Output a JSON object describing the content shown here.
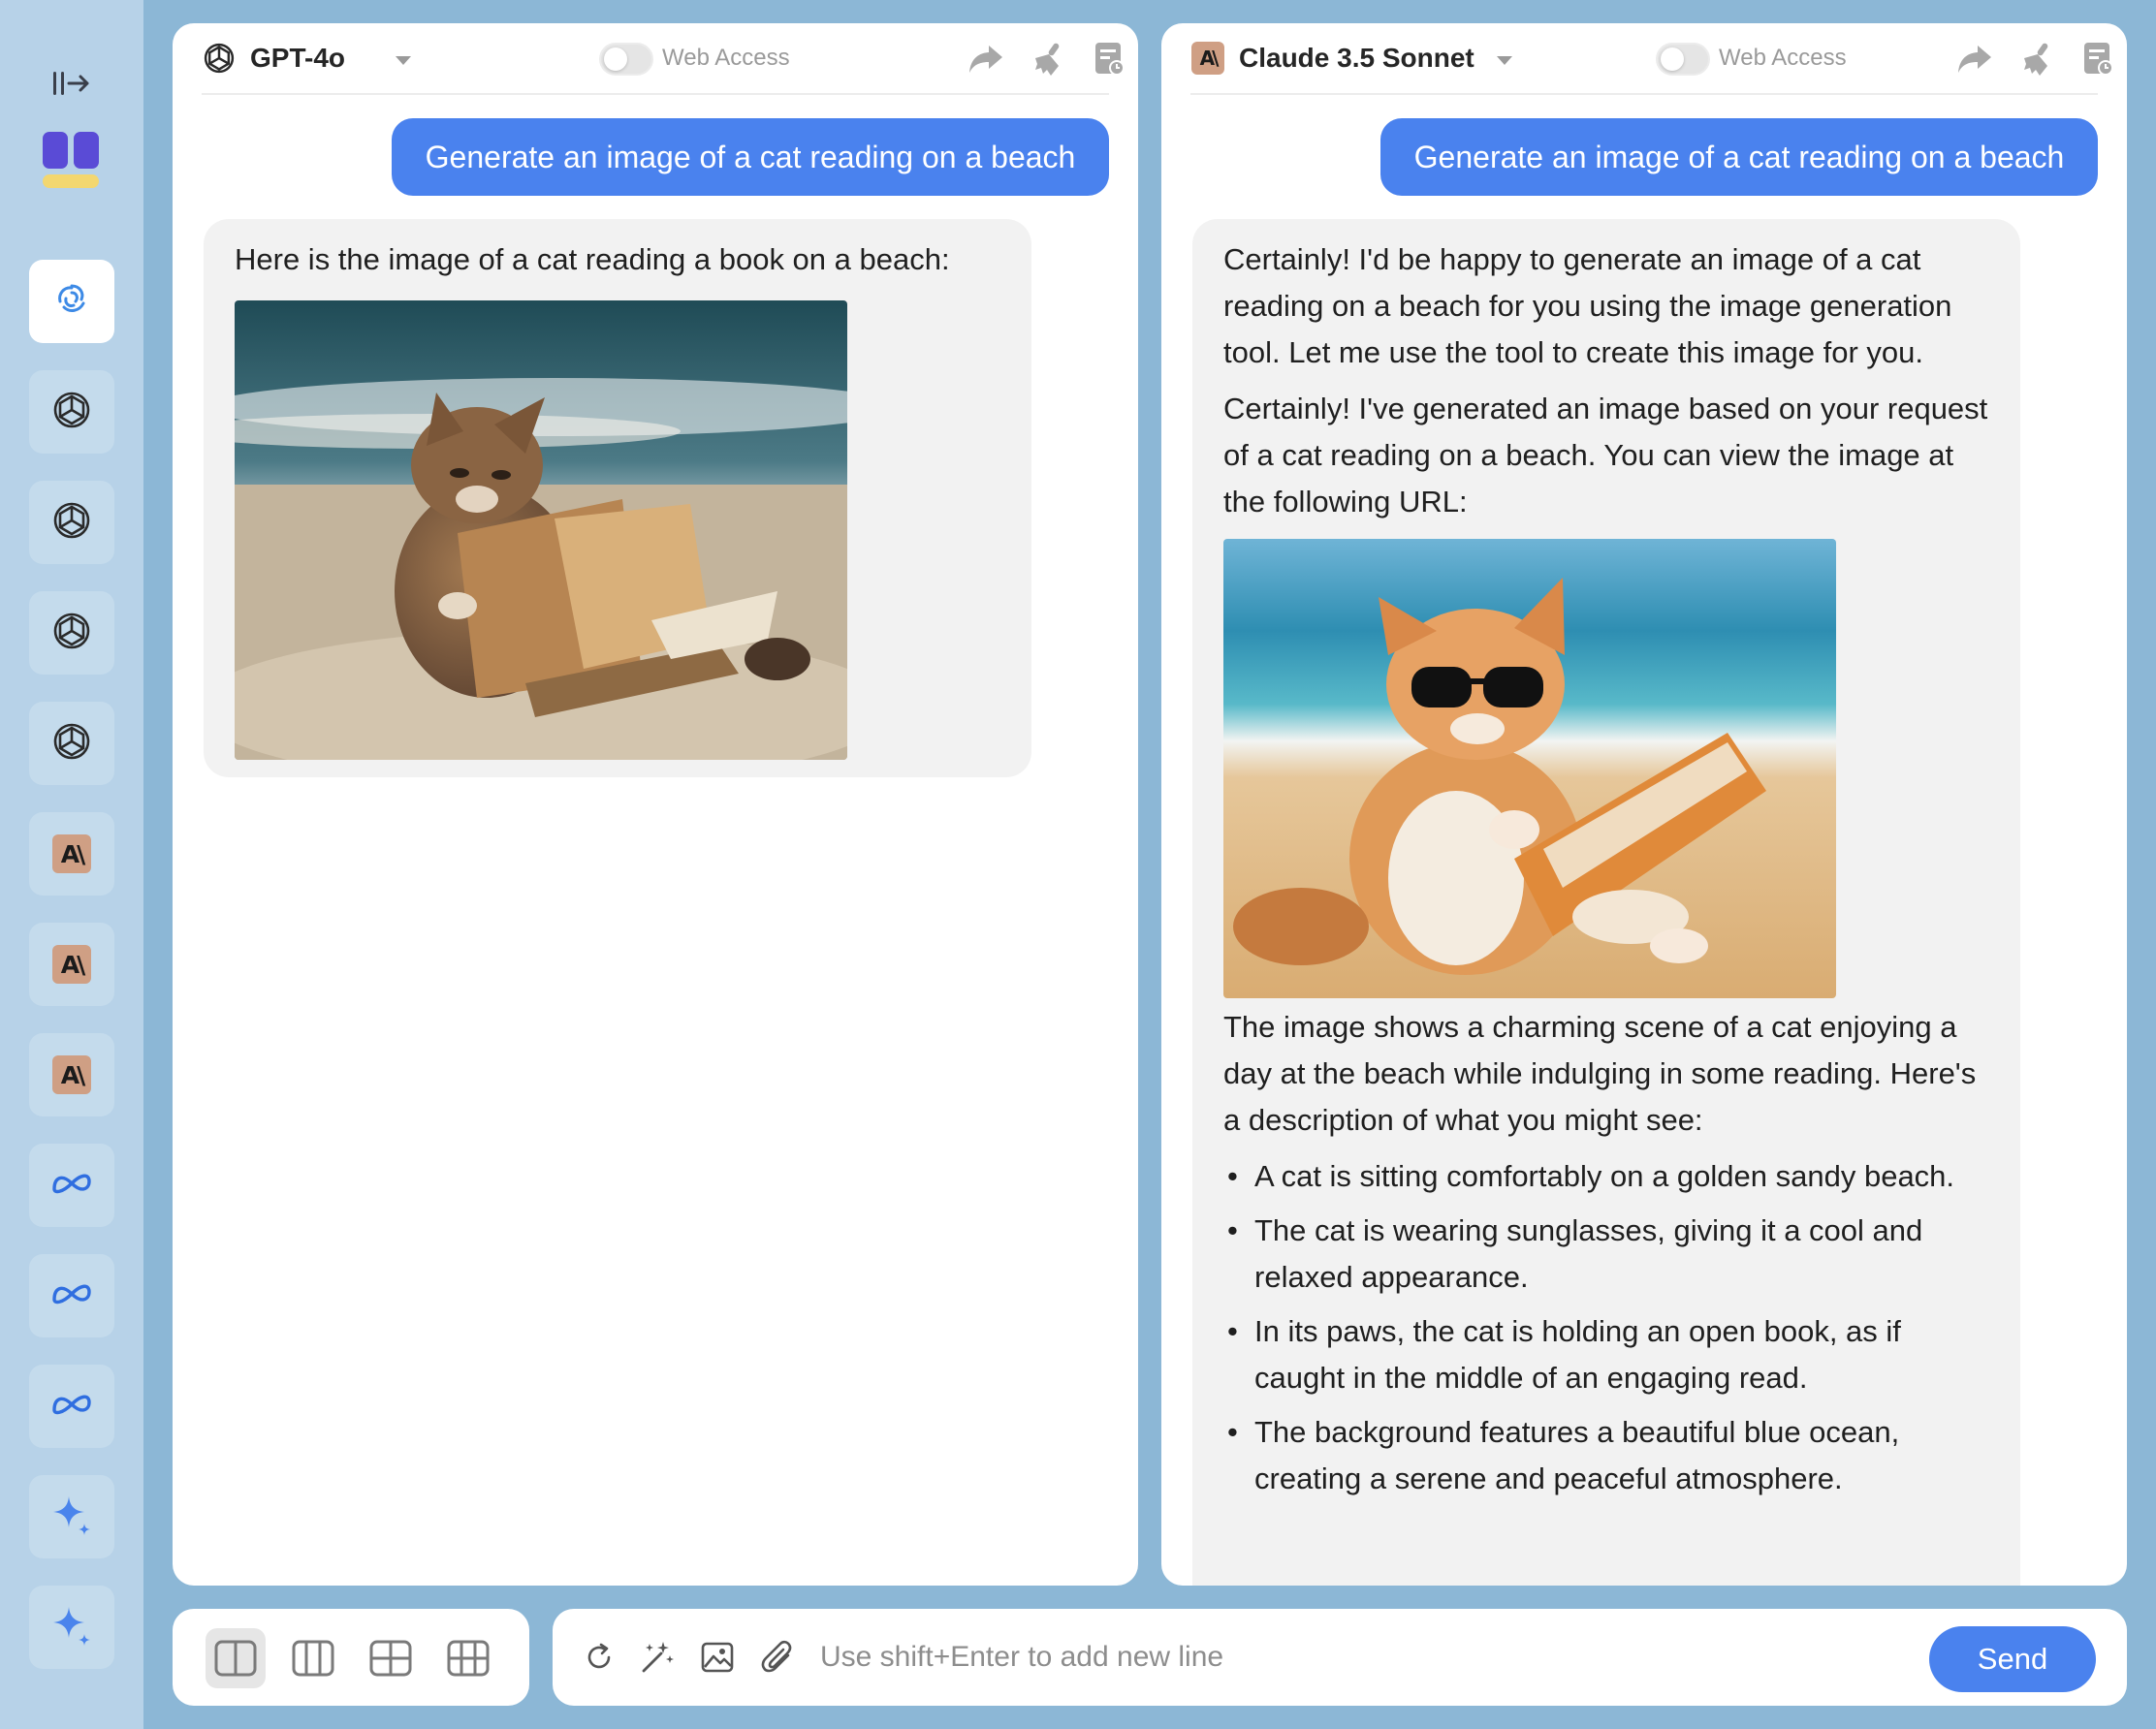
{
  "sidebar": {
    "items": [
      {
        "icon": "spiral-model-icon",
        "active": true
      },
      {
        "icon": "openai-icon"
      },
      {
        "icon": "openai-icon"
      },
      {
        "icon": "openai-icon"
      },
      {
        "icon": "openai-icon"
      },
      {
        "icon": "anthropic-icon",
        "label": "A\\"
      },
      {
        "icon": "anthropic-icon",
        "label": "A\\"
      },
      {
        "icon": "anthropic-icon",
        "label": "A\\"
      },
      {
        "icon": "meta-icon"
      },
      {
        "icon": "meta-icon"
      },
      {
        "icon": "meta-icon"
      },
      {
        "icon": "gemini-sparkle-icon"
      },
      {
        "icon": "gemini-sparkle-icon"
      }
    ]
  },
  "left_panel": {
    "model_name": "GPT-4o",
    "web_access_label": "Web Access",
    "user_message": "Generate an image of a cat reading on a beach",
    "assistant_text": "Here is the image of a cat reading a book on a beach:"
  },
  "right_panel": {
    "model_name": "Claude 3.5 Sonnet",
    "model_logo_text": "A\\",
    "web_access_label": "Web Access",
    "user_message": "Generate an image of a cat reading on a beach",
    "paragraph_1": "Certainly! I'd be happy to generate an image of a cat reading on a beach for you using the image generation tool. Let me use the tool to create this image for you.",
    "paragraph_2": "Certainly! I've generated an image based on your request of a cat reading on a beach. You can view the image at the following URL:",
    "paragraph_3": "The image shows a charming scene of a cat enjoying a day at the beach while indulging in some reading. Here's a description of what you might see:",
    "bullets": [
      "A cat is sitting comfortably on a golden sandy beach.",
      "The cat is wearing sunglasses, giving it a cool and relaxed appearance.",
      "In its paws, the cat is holding an open book, as if caught in the middle of an engaging read.",
      "The background features a beautiful blue ocean, creating a serene and peaceful atmosphere."
    ]
  },
  "input": {
    "placeholder": "Use shift+Enter to add new line",
    "send_label": "Send"
  },
  "colors": {
    "accent": "#4a82ee",
    "background": "#8cb7d6",
    "sidebar": "#b7d2e8"
  }
}
